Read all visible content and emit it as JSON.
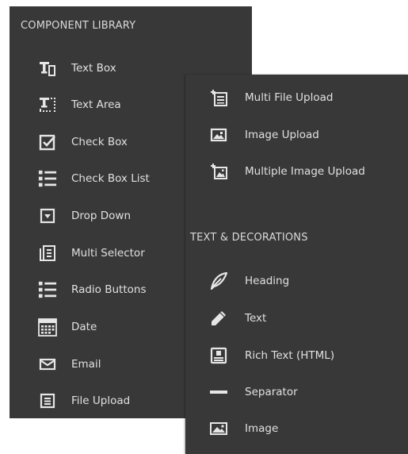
{
  "library": {
    "header": "COMPONENT LIBRARY",
    "items": [
      {
        "label": "Text Box",
        "icon": "text-box-icon"
      },
      {
        "label": "Text Area",
        "icon": "text-area-icon"
      },
      {
        "label": "Check Box",
        "icon": "check-box-icon"
      },
      {
        "label": "Check Box List",
        "icon": "check-box-list-icon"
      },
      {
        "label": "Drop Down",
        "icon": "drop-down-icon"
      },
      {
        "label": "Multi Selector",
        "icon": "multi-selector-icon"
      },
      {
        "label": "Radio Buttons",
        "icon": "radio-buttons-icon"
      },
      {
        "label": "Date",
        "icon": "calendar-icon"
      },
      {
        "label": "Email",
        "icon": "envelope-icon"
      },
      {
        "label": "File Upload",
        "icon": "file-upload-icon"
      }
    ]
  },
  "uploads": {
    "items": [
      {
        "label": "Multi File Upload",
        "icon": "multi-file-upload-icon"
      },
      {
        "label": "Image Upload",
        "icon": "image-upload-icon"
      },
      {
        "label": "Multiple Image Upload",
        "icon": "multiple-image-upload-icon"
      }
    ]
  },
  "decorations": {
    "header": "TEXT & DECORATIONS",
    "items": [
      {
        "label": "Heading",
        "icon": "quill-pen-icon"
      },
      {
        "label": "Text",
        "icon": "pencil-icon"
      },
      {
        "label": "Rich Text (HTML)",
        "icon": "rich-text-icon"
      },
      {
        "label": "Separator",
        "icon": "separator-icon"
      },
      {
        "label": "Image",
        "icon": "image-icon"
      }
    ]
  },
  "colors": {
    "panel_bg": "#383838",
    "text": "#e0e0e0",
    "icon": "#e6e6e6"
  }
}
